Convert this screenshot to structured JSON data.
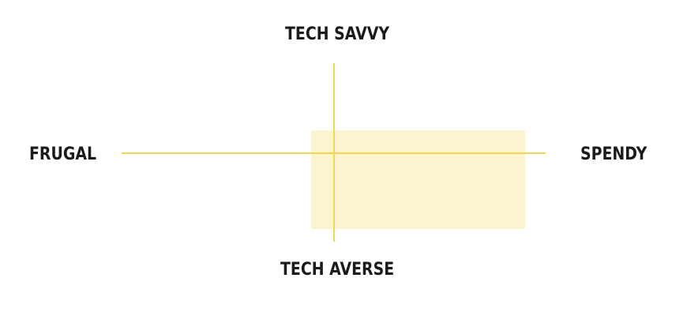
{
  "axes": {
    "top_label": "TECH SAVVY",
    "bottom_label": "TECH AVERSE",
    "left_label": "FRUGAL",
    "right_label": "SPENDY"
  },
  "colors": {
    "axis_line": "#f3d651",
    "highlight_region": "#fcf3cf",
    "label_text": "#1b1b1b",
    "background": "#ffffff"
  }
}
